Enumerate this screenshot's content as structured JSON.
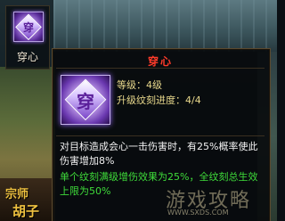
{
  "skill_slot": {
    "icon": "engrave-skill-icon",
    "glyph": "穿",
    "name": "穿心"
  },
  "tooltip": {
    "title": "穿心",
    "title_color": "#ff3b2a",
    "icon": "engrave-skill-icon",
    "glyph": "穿",
    "level": "等级：4级",
    "upgrade_progress": "升级纹刻进度：4/4",
    "description": "对目标造成会心一击伤害时，有25%概率使此伤害增加8%",
    "bonus": "单个纹刻满级增伤效果为25%，全纹刻总生效上限为50%",
    "bonus_color": "#3fdc3a"
  },
  "background": {
    "sign_line1": "宗师",
    "sign_line2": "胡子"
  },
  "watermark": {
    "text": "游戏攻略",
    "url": "WWW.SXDS.COM"
  }
}
